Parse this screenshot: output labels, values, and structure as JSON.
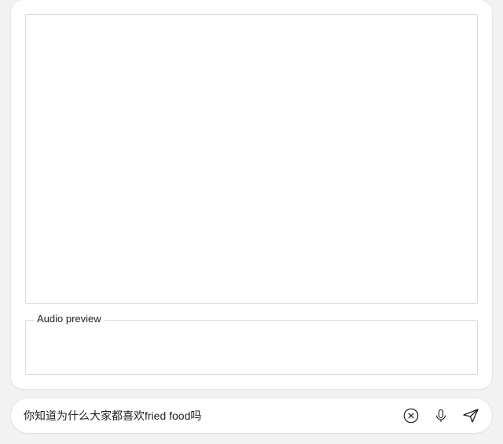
{
  "main": {
    "textarea_value": "",
    "audio_preview_label": "Audio preview"
  },
  "composer": {
    "input_value": "你知道为什么大家都喜欢fried food吗"
  },
  "icons": {
    "close": "close-icon",
    "mic": "mic-icon",
    "send": "send-icon"
  }
}
